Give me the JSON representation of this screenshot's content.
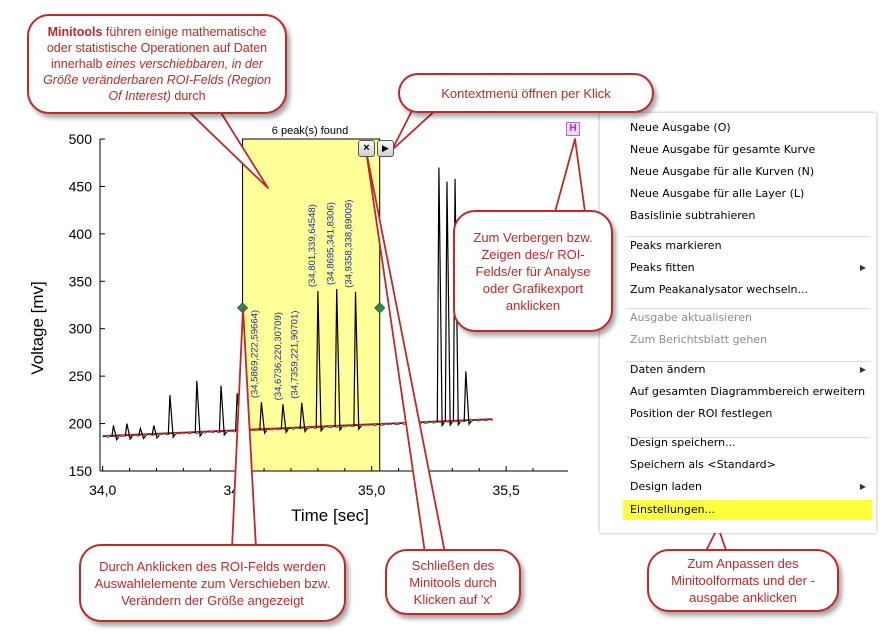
{
  "roi": {
    "title": "6 peak(s) found",
    "x_start": 34.52,
    "x_end": 35.03,
    "close_label": "×",
    "menu_label": "▶"
  },
  "toggle": {
    "label": "H"
  },
  "colors": {
    "roi_fill": "#ffff99",
    "signal": "#000000",
    "baseline": "#b22222",
    "callout": "#c0282a",
    "handle": "#2e8b57",
    "menu_highlight": "#ffff3c"
  },
  "chart_data": {
    "type": "line",
    "xlabel": "Time [sec]",
    "ylabel": "Voltage [mv]",
    "xlim": [
      33.99,
      35.73
    ],
    "ylim": [
      150,
      500
    ],
    "xticks": [
      34.0,
      34.5,
      35.0,
      35.5
    ],
    "xtick_labels": [
      "34,0",
      "34,5",
      "35,0",
      "35,5"
    ],
    "yticks": [
      150,
      200,
      250,
      300,
      350,
      400,
      450,
      500
    ],
    "ytick_labels": [
      "150",
      "200",
      "250",
      "300",
      "350",
      "400",
      "450",
      "500"
    ],
    "baseline": {
      "x": [
        34.0,
        35.45
      ],
      "y": [
        187,
        205
      ]
    },
    "peaks": [
      {
        "x": 34.04,
        "y": 198
      },
      {
        "x": 34.09,
        "y": 200
      },
      {
        "x": 34.14,
        "y": 195
      },
      {
        "x": 34.19,
        "y": 198
      },
      {
        "x": 34.25,
        "y": 230
      },
      {
        "x": 34.35,
        "y": 245
      },
      {
        "x": 34.44,
        "y": 240
      },
      {
        "x": 34.5,
        "y": 232
      },
      {
        "x": 34.59,
        "y": 222.6
      },
      {
        "x": 34.67,
        "y": 220.3
      },
      {
        "x": 34.74,
        "y": 221.9
      },
      {
        "x": 34.8,
        "y": 339.6
      },
      {
        "x": 34.87,
        "y": 341.8
      },
      {
        "x": 34.94,
        "y": 338.9
      },
      {
        "x": 35.25,
        "y": 470
      },
      {
        "x": 35.28,
        "y": 455
      },
      {
        "x": 35.31,
        "y": 458
      },
      {
        "x": 35.35,
        "y": 255
      }
    ],
    "peak_labels": [
      {
        "x": 34.5869,
        "y": 222.59664,
        "text": "(34,5869,222,59664)"
      },
      {
        "x": 34.6736,
        "y": 220.30709,
        "text": "(34,6736,220,30709)"
      },
      {
        "x": 34.7359,
        "y": 221.90701,
        "text": "(34,7359,221,90701)"
      },
      {
        "x": 34.801,
        "y": 339.64548,
        "text": "(34,801,339,64548)"
      },
      {
        "x": 34.8695,
        "y": 341.8306,
        "text": "(34,8695,341,8306)"
      },
      {
        "x": 34.9358,
        "y": 338.89009,
        "text": "(34,9358,338,89009)"
      }
    ]
  },
  "context_menu": {
    "items": [
      {
        "label": "Neue Ausgabe (O)"
      },
      {
        "label": "Neue Ausgabe für gesamte Kurve"
      },
      {
        "label": "Neue Ausgabe für alle Kurven (N)"
      },
      {
        "label": "Neue Ausgabe für alle Layer (L)"
      },
      {
        "label": "Basislinie subtrahieren"
      },
      {
        "label": "Peaks markieren"
      },
      {
        "label": "Peaks fitten",
        "submenu": true
      },
      {
        "label": "Zum Peakanalysator wechseln..."
      },
      {
        "label": "Ausgabe aktualisieren",
        "disabled": true
      },
      {
        "label": "Zum Berichtsblatt gehen",
        "disabled": true
      },
      {
        "label": "Daten ändern",
        "submenu": true
      },
      {
        "label": "Auf gesamten Diagrammbereich erweitern"
      },
      {
        "label": "Position der ROI festlegen"
      },
      {
        "label": "Design speichern..."
      },
      {
        "label": "Speichern als <Standard>"
      },
      {
        "label": "Design laden",
        "submenu": true
      },
      {
        "label": "Einstellungen...",
        "highlight": true
      }
    ]
  },
  "callouts": {
    "intro": {
      "bold": "Minitools",
      "text1": " führen einige mathematische oder statistische Operationen auf Daten innerhalb ",
      "italic": "eines verschiebbaren, in der Größe veränderbaren ROI-Felds (Region Of Interest)",
      "text2": " durch"
    },
    "context_menu_open": "Kontextmenü öffnen per Klick",
    "toggle_roi": "Zum Verbergen bzw. Zeigen des/r ROI-Felds/er für Analyse oder Grafikexport anklicken",
    "click_roi": "Durch Anklicken des ROI-Felds werden Auswahlelemente zum Verschieben bzw. Verändern der Größe angezeigt",
    "close_minitool": "Schließen des Minitools durch Klicken auf 'x'",
    "settings": "Zum Anpassen des Minitoolformats und der -ausgabe anklicken"
  }
}
